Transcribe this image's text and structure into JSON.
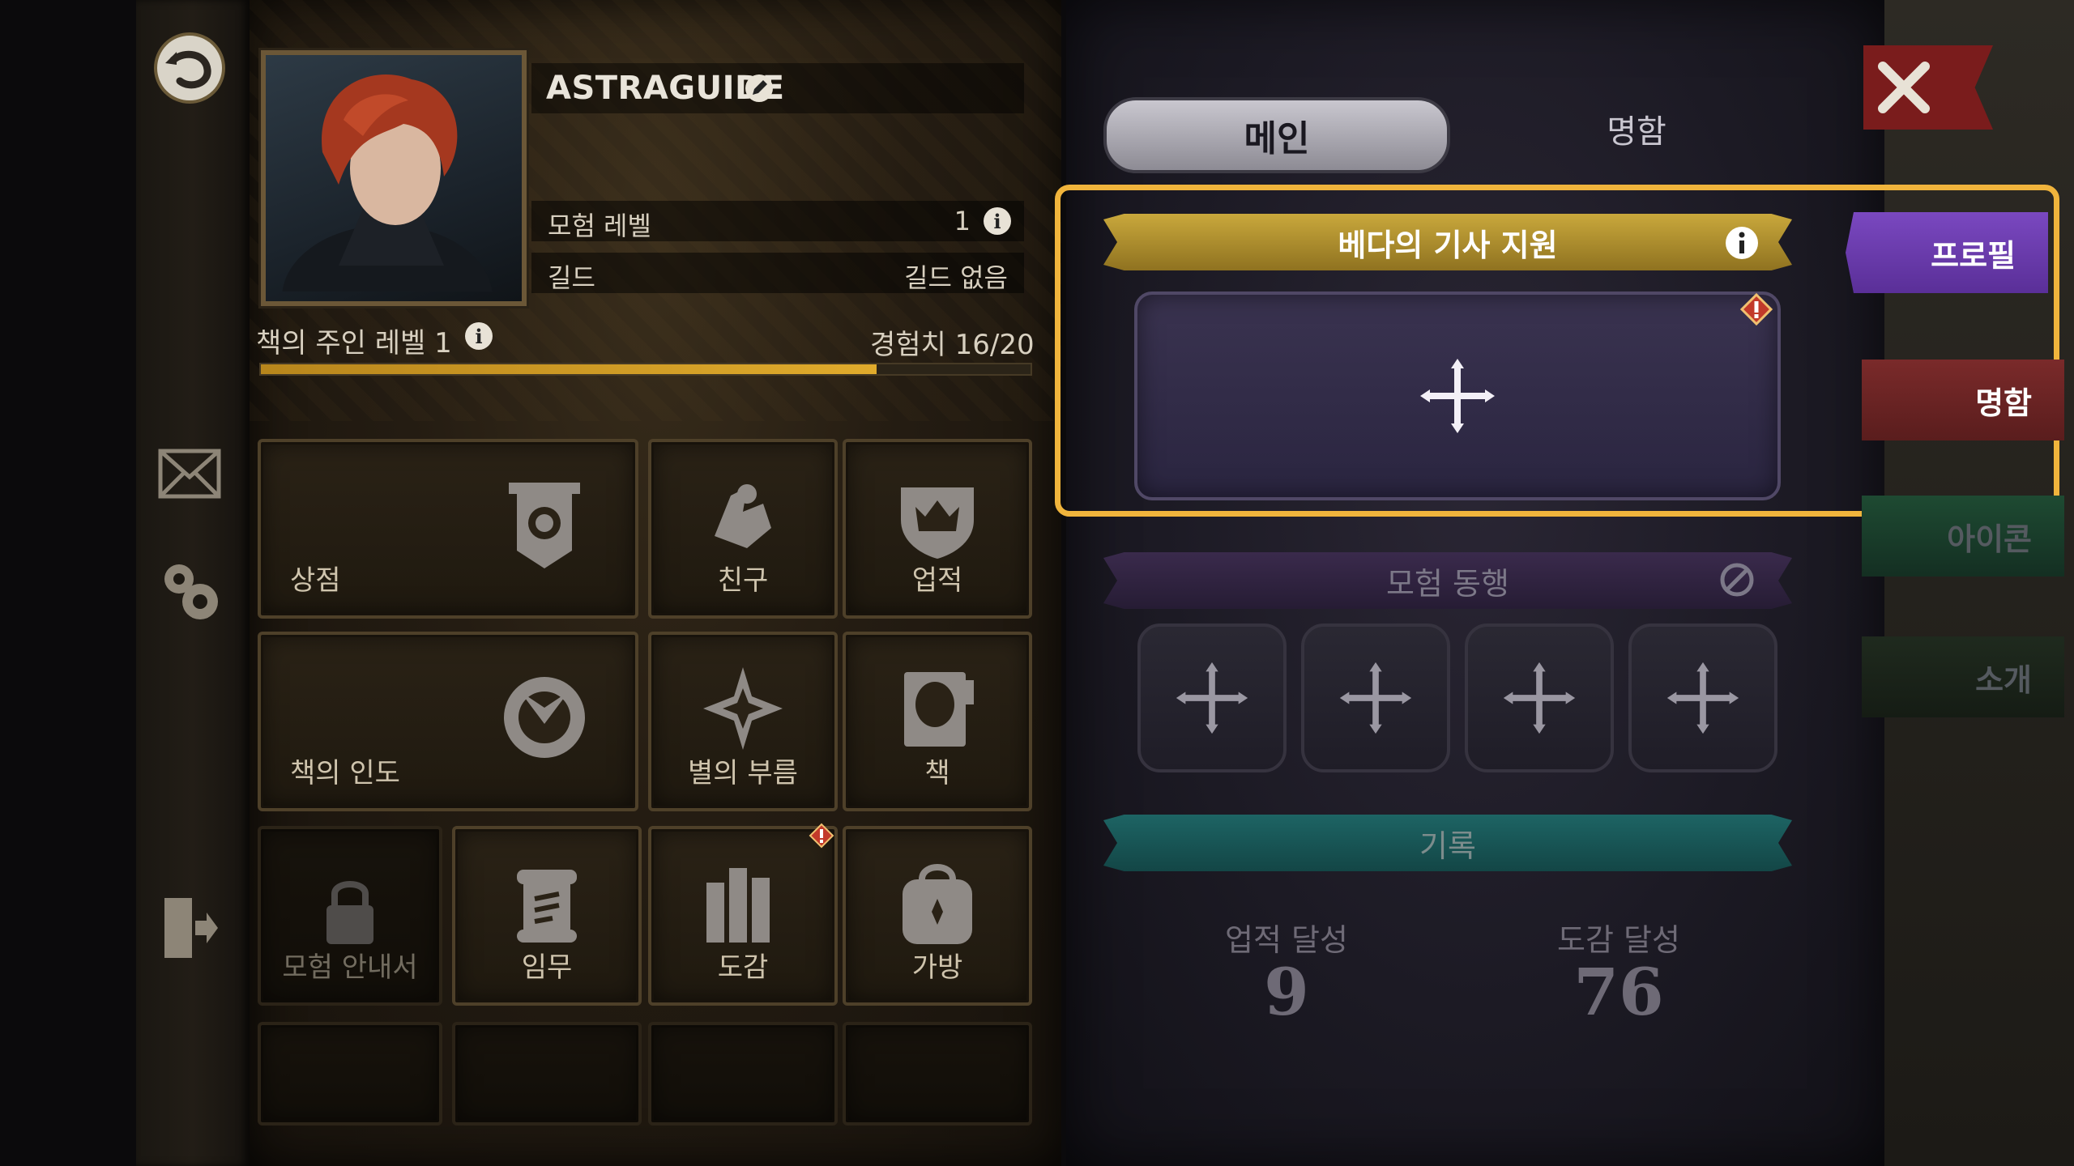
{
  "profile": {
    "name": "ASTRAGUIDE",
    "adventure_level_label": "모험 레벨",
    "adventure_level_value": "1",
    "guild_label": "길드",
    "guild_value": "길드 없음",
    "book_owner_level": "책의 주인 레벨 1",
    "exp_text": "경험치 16/20",
    "exp_progress": 0.8
  },
  "menu": {
    "shop": "상점",
    "friends": "친구",
    "achievements": "업적",
    "book_guide": "책의 인도",
    "star_call": "별의 부름",
    "book": "책",
    "adventure_guide": "모험 안내서",
    "quest": "임무",
    "codex": "도감",
    "bag": "가방"
  },
  "tabs": {
    "main": "메인",
    "card": "명함"
  },
  "sections": {
    "support_title": "베다의 기사 지원",
    "companion_title": "모험 동행",
    "record_title": "기록"
  },
  "records": {
    "achievement_label": "업적 달성",
    "achievement_value": "9",
    "codex_label": "도감 달성",
    "codex_value": "76"
  },
  "side_tabs": {
    "profile": "프로필",
    "card": "명함",
    "icon": "아이콘",
    "intro": "소개"
  },
  "colors": {
    "highlight": "#f0b43c",
    "gold_ribbon": "#b8962e",
    "purple_ribbon": "#3a2a4c",
    "teal_ribbon": "#1b5a5a",
    "profile_tab": "#6a3aa8",
    "card_tab": "#7a2a2a"
  }
}
